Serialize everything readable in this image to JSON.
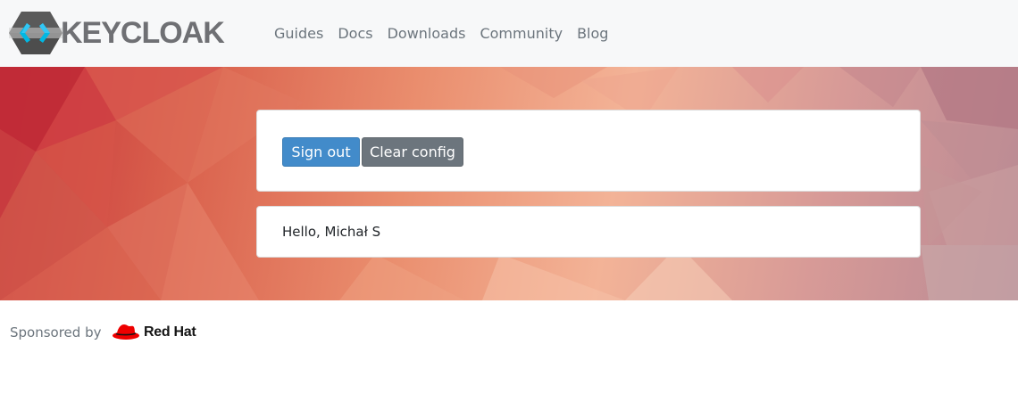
{
  "brand": {
    "name": "KEYCLOAK"
  },
  "nav": {
    "items": [
      {
        "label": "Guides"
      },
      {
        "label": "Docs"
      },
      {
        "label": "Downloads"
      },
      {
        "label": "Community"
      },
      {
        "label": "Blog"
      }
    ]
  },
  "actions": {
    "sign_out_label": "Sign out",
    "clear_config_label": "Clear config"
  },
  "greeting": {
    "text": "Hello, Michał S"
  },
  "footer": {
    "sponsored_label": "Sponsored by",
    "sponsor_name": "Red Hat"
  },
  "colors": {
    "primary": "#428bca",
    "secondary": "#6c757d",
    "navbar_bg": "#f7f8f9",
    "redhat_red": "#ee0000"
  }
}
